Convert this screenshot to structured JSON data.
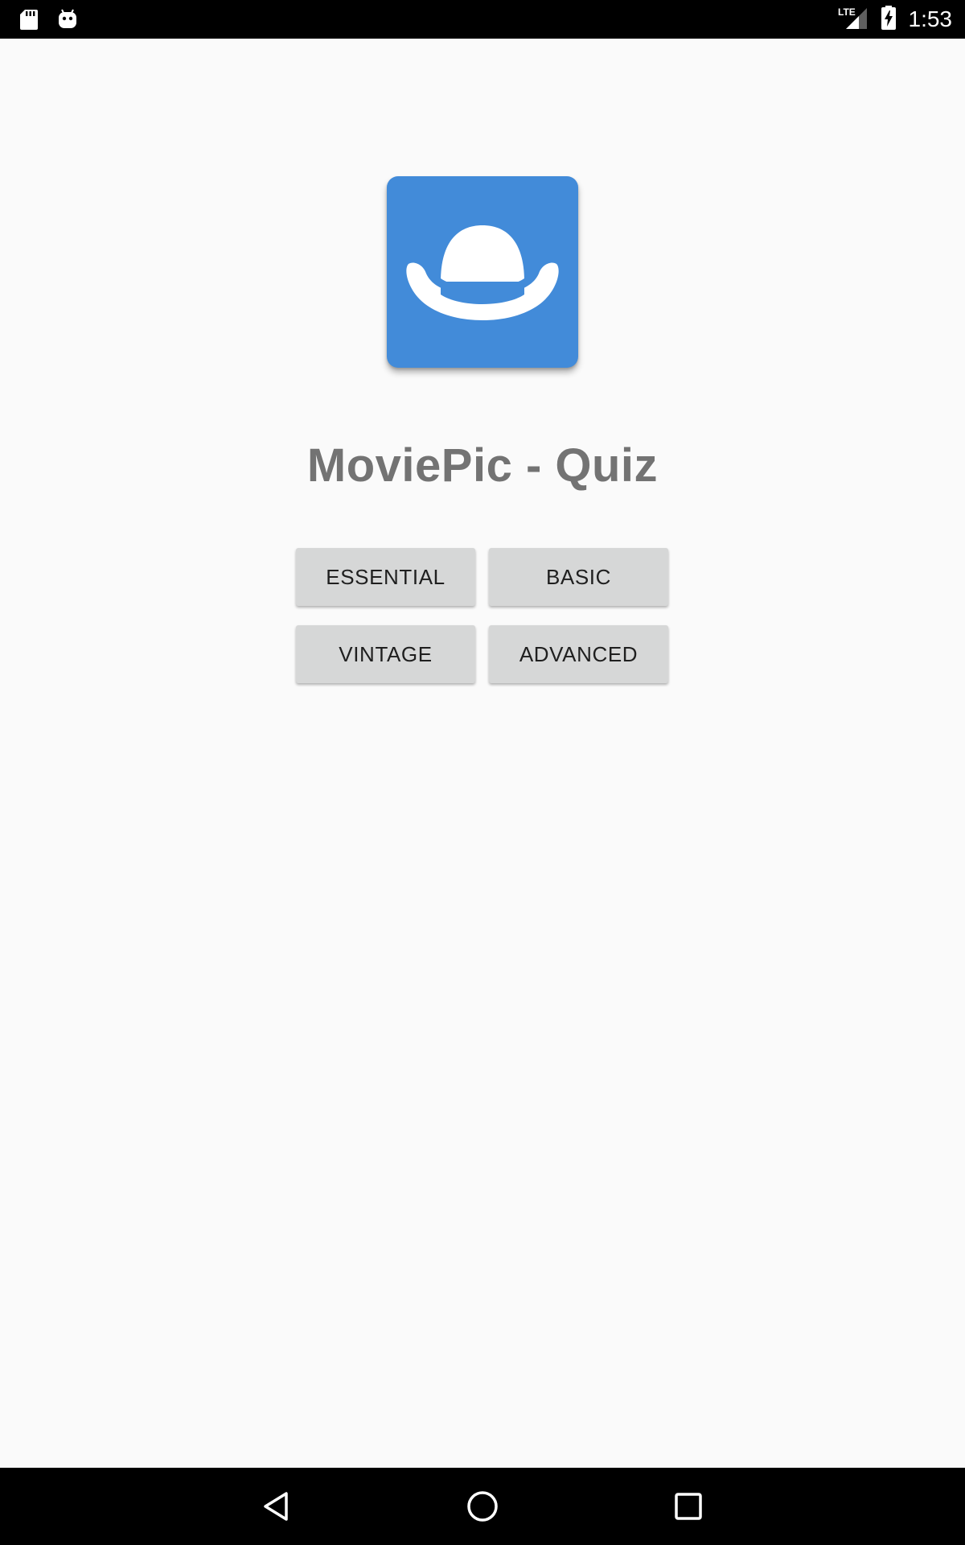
{
  "status_bar": {
    "time": "1:53",
    "network": "LTE",
    "left_icons": [
      "sd-card-icon",
      "android-debug-icon"
    ],
    "right_icons": [
      "lte-signal-icon",
      "battery-charging-icon"
    ]
  },
  "app": {
    "icon": "bowler-hat-icon",
    "title": "MoviePic - Quiz",
    "accent_color": "#428bd9"
  },
  "levels": {
    "essential": "ESSENTIAL",
    "basic": "BASIC",
    "vintage": "VINTAGE",
    "advanced": "ADVANCED"
  },
  "nav_bar": {
    "buttons": [
      "back-icon",
      "home-icon",
      "recents-icon"
    ]
  }
}
